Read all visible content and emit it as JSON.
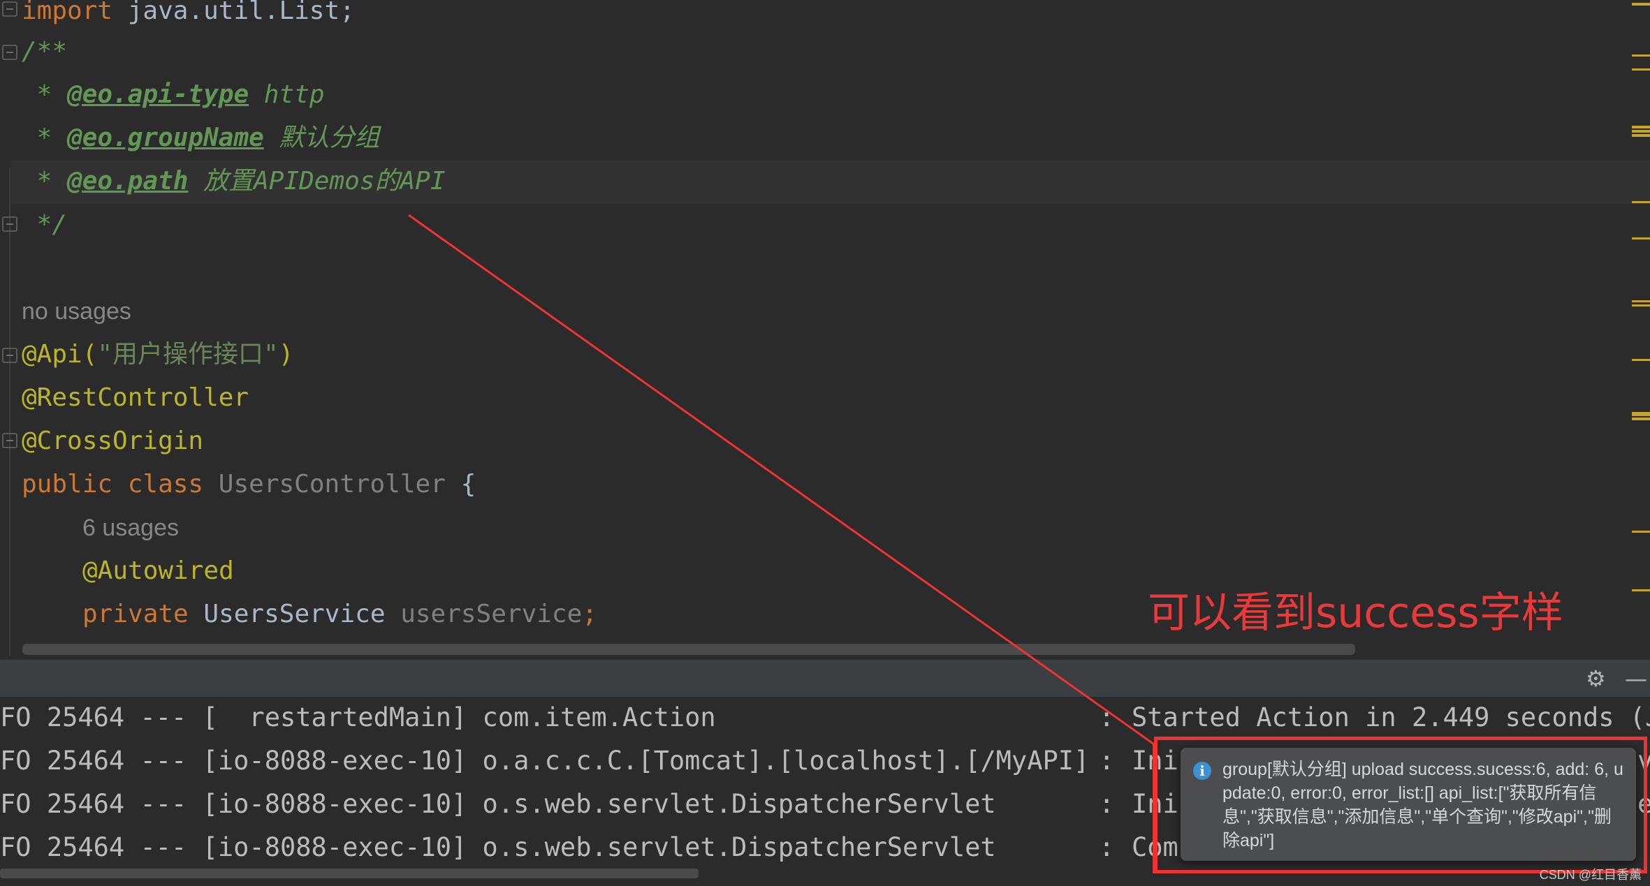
{
  "editor": {
    "lines": {
      "import": {
        "kw": "import",
        "rest": " java.util.List;"
      },
      "doc_open": "/**",
      "doc_api_type": {
        "star": " * ",
        "tag": "@eo.api-type",
        "value": " http"
      },
      "doc_group": {
        "star": " * ",
        "tag": "@eo.groupName",
        "value": " 默认分组"
      },
      "doc_path": {
        "star": " * ",
        "tag": "@eo.path",
        "value": " 放置APIDemos的API"
      },
      "doc_close": " */",
      "usage_hint_class": "no usages",
      "api": {
        "anno": "@Api(",
        "str": "\"用户操作接口\"",
        "close": ")"
      },
      "rest_controller": "@RestController",
      "cross_origin": "@CrossOrigin",
      "class_decl": {
        "kw1": "public",
        "kw2": "class",
        "name": "UsersController",
        "brace": "{"
      },
      "usage_hint_field": "6 usages",
      "autowired": "@Autowired",
      "field_decl": {
        "kw": "private",
        "type": "UsersService",
        "name": "usersService",
        "semi": ";"
      }
    }
  },
  "console": {
    "logs": [
      {
        "left": "FO 25464 --- [  restartedMain] com.item.Action",
        "sep": ":",
        "right": "Started Action in 2.449 seconds (J"
      },
      {
        "left": "FO 25464 --- [io-8088-exec-10] o.a.c.c.C.[Tomcat].[localhost].[/MyAPI]",
        "sep": ":",
        "right": "Ini"
      },
      {
        "left": "FO 25464 --- [io-8088-exec-10] o.s.web.servlet.DispatcherServlet",
        "sep": ":",
        "right": "Ini"
      },
      {
        "left": "FO 25464 --- [io-8088-exec-10] o.s.web.servlet.DispatcherServlet",
        "sep": ":",
        "right": "Com"
      }
    ],
    "clipped_right": [
      "v",
      "e"
    ],
    "header_icons": {
      "settings": "gear-icon",
      "minimize": "minimize-icon"
    }
  },
  "notification": {
    "message": "group[默认分组] upload success.sucess:6, add: 6, update:0, error:0, error_list:[] api_list:[\"获取所有信息\",\"获取信息\",\"添加信息\",\"单个查询\",\"修改api\",\"删除api\"]",
    "icon": "info-icon"
  },
  "annotation": {
    "caption": "可以看到success字样",
    "color": "#ee3333"
  },
  "watermark": "CSDN @红目香薰"
}
